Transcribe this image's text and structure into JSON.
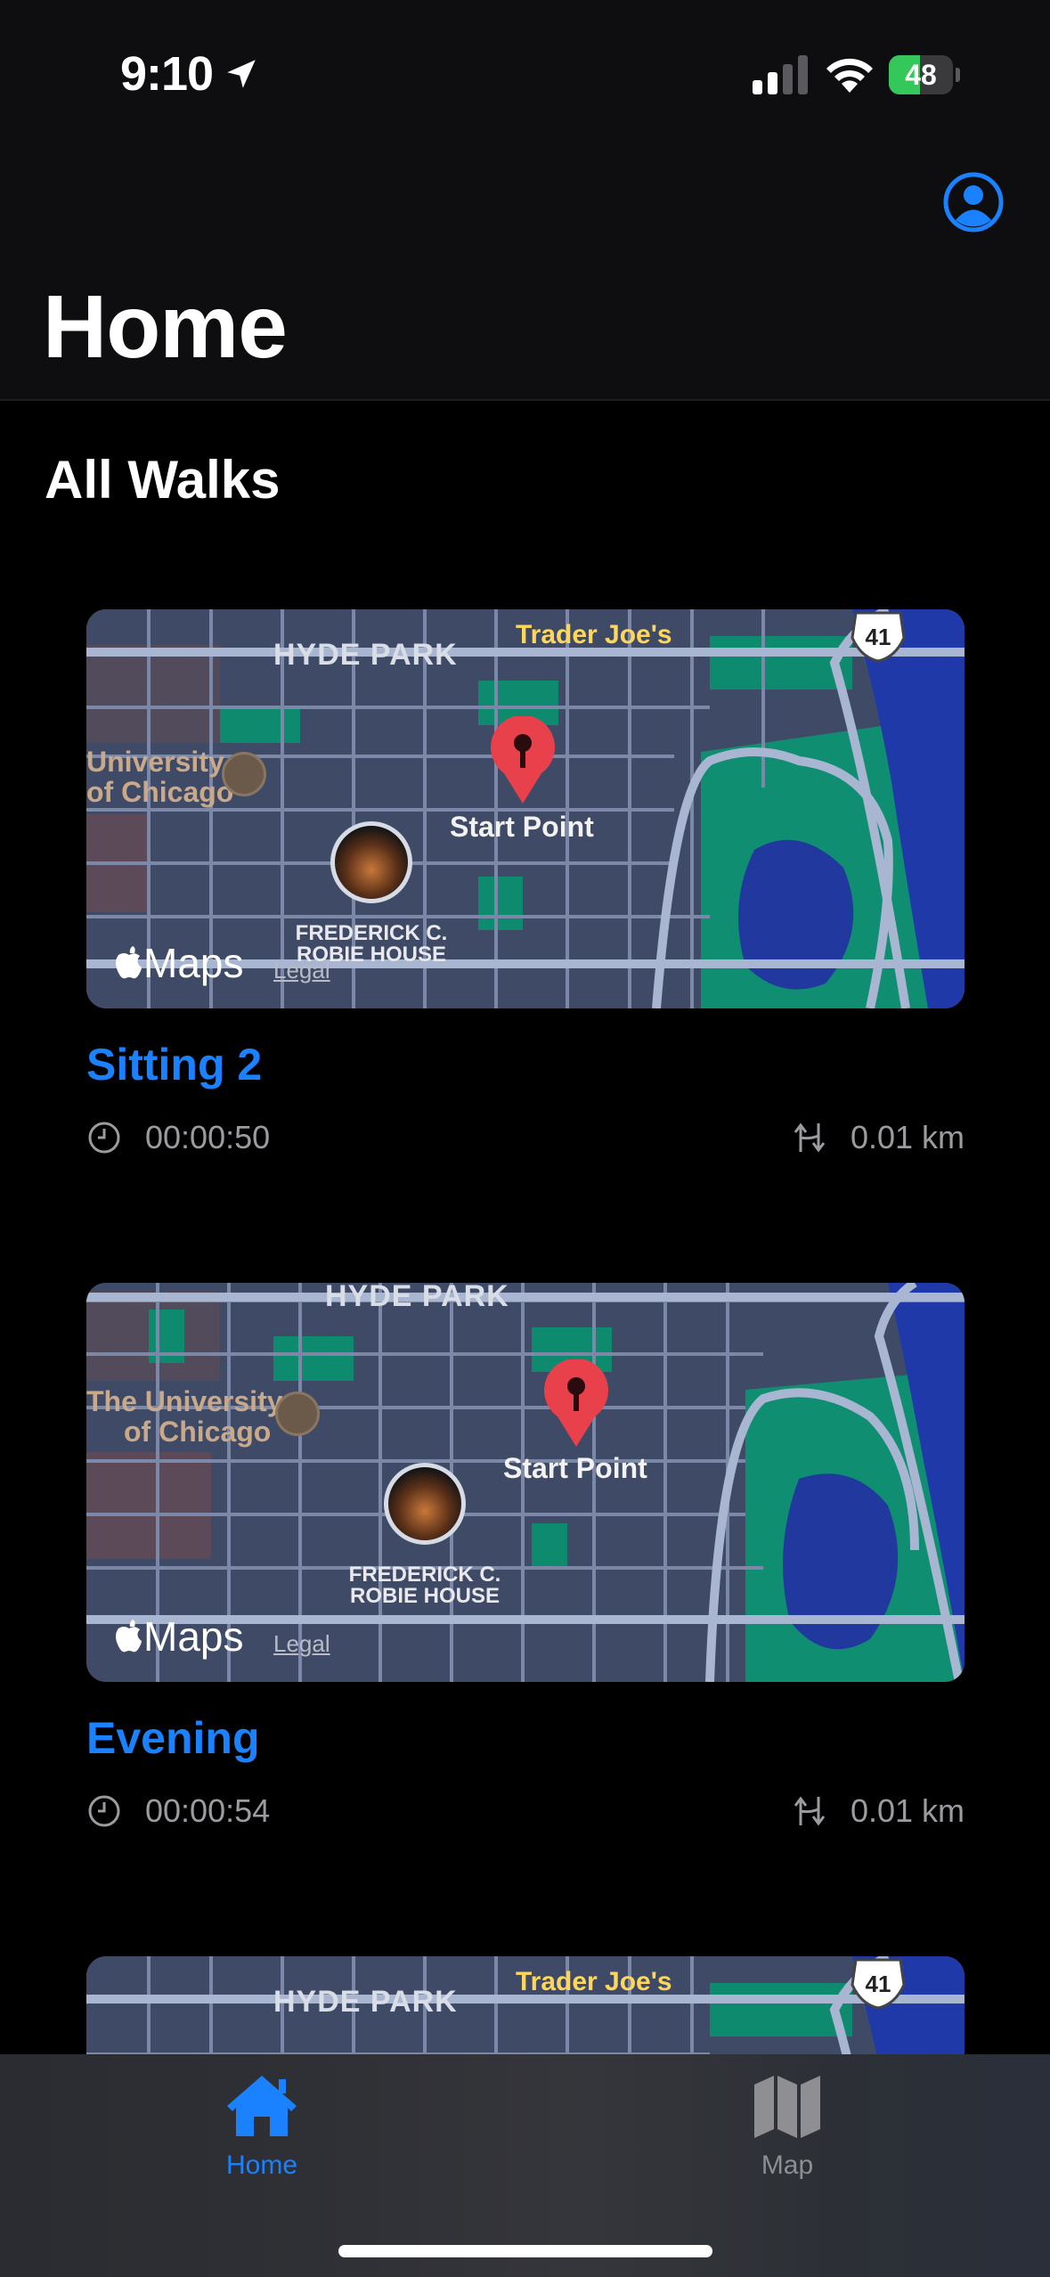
{
  "status_bar": {
    "time": "9:10",
    "battery_level": 48,
    "battery_label": "48",
    "icons": [
      "location-arrow-icon",
      "cellular-signal-icon",
      "wifi-icon",
      "battery-charging-icon"
    ]
  },
  "header": {
    "title": "Home",
    "profile_icon": "person-circle-icon"
  },
  "section": {
    "title": "All Walks"
  },
  "map_labels": {
    "district": "HYDE PARK",
    "poi": "Trader Joe's",
    "university_line1": "University",
    "university_line1_alt": "The University",
    "university_line2": "of Chicago",
    "start_point": "Start Point",
    "landmark_line1": "FREDERICK C.",
    "landmark_line2": "ROBIE HOUSE",
    "maps_brand": "Maps",
    "legal": "Legal",
    "highway": "41"
  },
  "walks": [
    {
      "name": "Sitting 2",
      "duration": "00:00:50",
      "distance": "0.01 km"
    },
    {
      "name": "Evening",
      "duration": "00:00:54",
      "distance": "0.01 km"
    },
    {
      "name": "",
      "duration": "",
      "distance": ""
    }
  ],
  "tab_bar": {
    "tabs": [
      {
        "label": "Home",
        "icon": "house-fill-icon",
        "selected": true
      },
      {
        "label": "Map",
        "icon": "map-fill-icon",
        "selected": false
      }
    ]
  },
  "colors": {
    "accent": "#1a82ff",
    "background": "#000000",
    "header_background": "#0e0e10",
    "secondary_text": "#9b9ba0",
    "battery_green": "#34c759",
    "pin_red": "#e8414b"
  }
}
